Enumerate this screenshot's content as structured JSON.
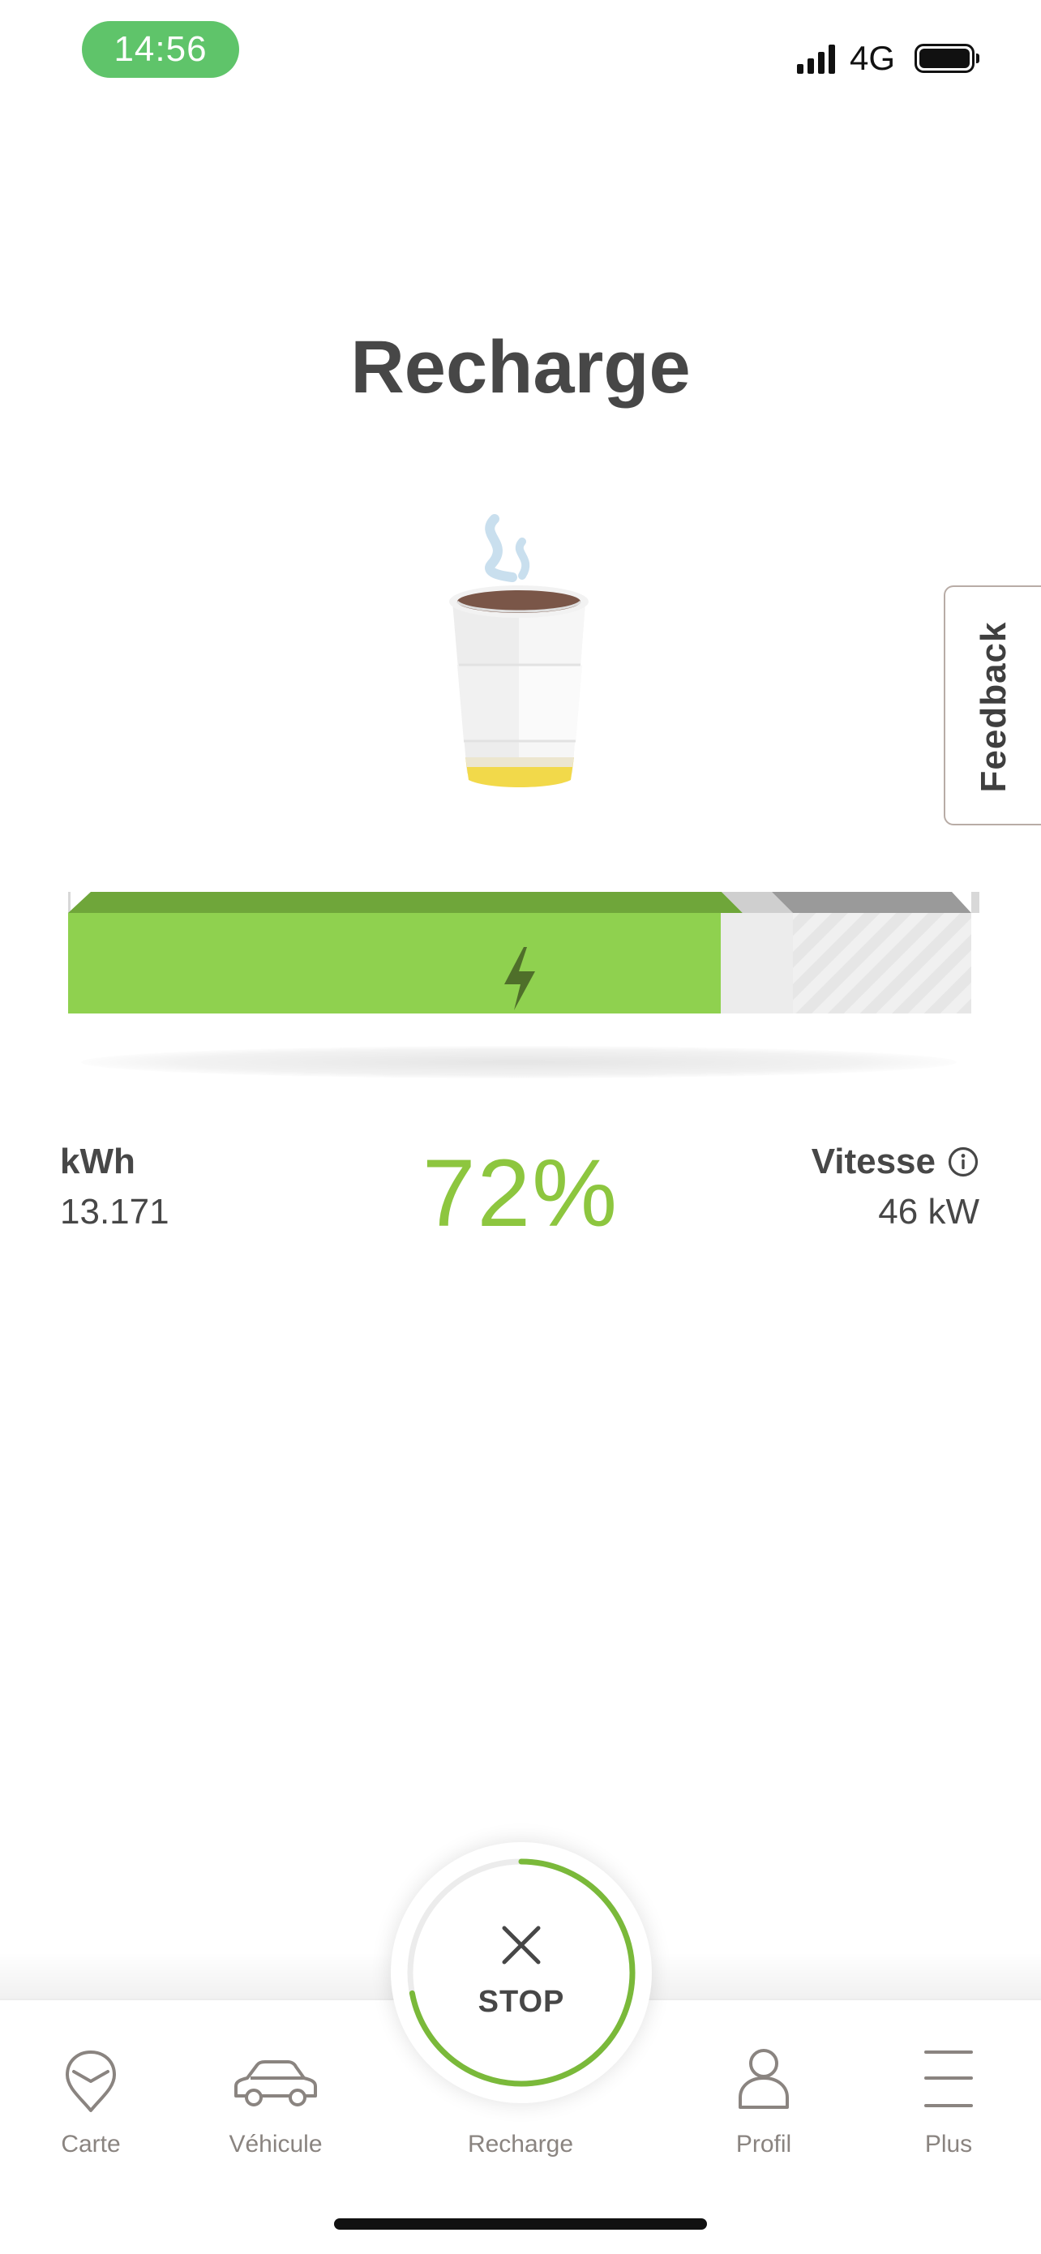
{
  "status_bar": {
    "time": "14:56",
    "network": "4G",
    "signal_icon": "signal-bars-icon",
    "battery_icon": "battery-full-icon"
  },
  "page": {
    "title": "Recharge",
    "illustration": "coffee-cup-icon"
  },
  "feedback": {
    "label": "Feedback"
  },
  "charge": {
    "level_fraction": 0.72,
    "bar_icon": "lightning-bolt-icon",
    "colors": {
      "charged": "#8fd14f",
      "charged_top": "#6fa63a",
      "accent_green": "#8dc63f"
    }
  },
  "stats": {
    "energy_label": "kWh",
    "energy_value": "13.171",
    "percent": "72%",
    "speed_label": "Vitesse",
    "speed_value": "46 kW",
    "speed_info_icon": "info-icon"
  },
  "stop_button": {
    "label": "STOP",
    "icon": "close-icon",
    "progress_fraction": 0.72
  },
  "nav": {
    "items": [
      {
        "label": "Carte",
        "icon": "map-pin-icon"
      },
      {
        "label": "Véhicule",
        "icon": "car-icon"
      },
      {
        "label": "Recharge",
        "icon": "charging-icon"
      },
      {
        "label": "Profil",
        "icon": "user-icon"
      },
      {
        "label": "Plus",
        "icon": "menu-icon"
      }
    ]
  }
}
